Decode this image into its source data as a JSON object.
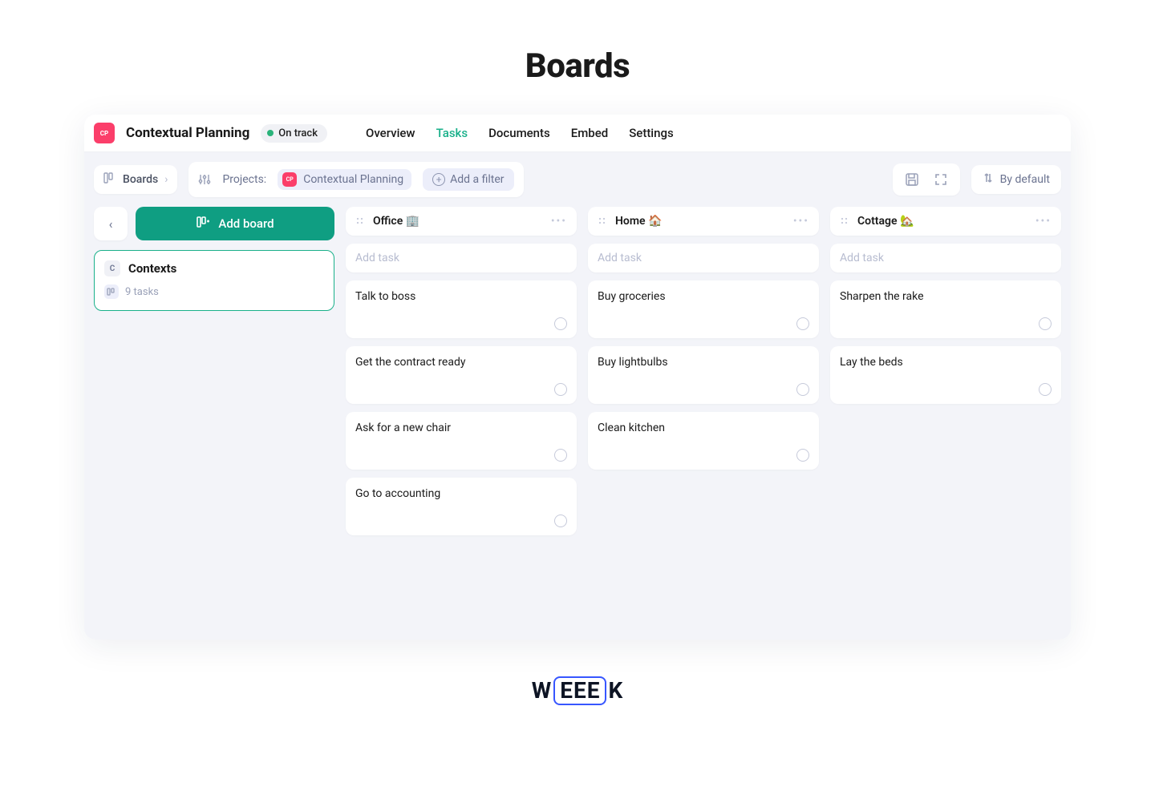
{
  "page_title": "Boards",
  "project": {
    "chip": "CP",
    "name": "Contextual Planning",
    "status": "On track"
  },
  "nav": {
    "items": [
      "Overview",
      "Tasks",
      "Documents",
      "Embed",
      "Settings"
    ],
    "active": "Tasks"
  },
  "toolbar": {
    "view_label": "Boards",
    "projects_label": "Projects:",
    "project_tag_chip": "CP",
    "project_tag_name": "Contextual Planning",
    "add_filter_label": "Add a filter",
    "sort_label": "By default"
  },
  "sidepanel": {
    "add_board_label": "Add board",
    "board": {
      "avatar_letter": "C",
      "title": "Contexts",
      "subtitle": "9 tasks"
    }
  },
  "columns": [
    {
      "title": "Office 🏢",
      "add_task_placeholder": "Add task",
      "tasks": [
        "Talk to boss",
        "Get the contract ready",
        "Ask for a new chair",
        "Go to accounting"
      ]
    },
    {
      "title": "Home 🏠",
      "add_task_placeholder": "Add task",
      "tasks": [
        "Buy groceries",
        "Buy lightbulbs",
        "Clean kitchen"
      ]
    },
    {
      "title": "Cottage 🏡",
      "add_task_placeholder": "Add task",
      "tasks": [
        "Sharpen the rake",
        "Lay the beds"
      ]
    }
  ],
  "logo": {
    "w": "W",
    "ee": "EEE",
    "k": "K"
  }
}
